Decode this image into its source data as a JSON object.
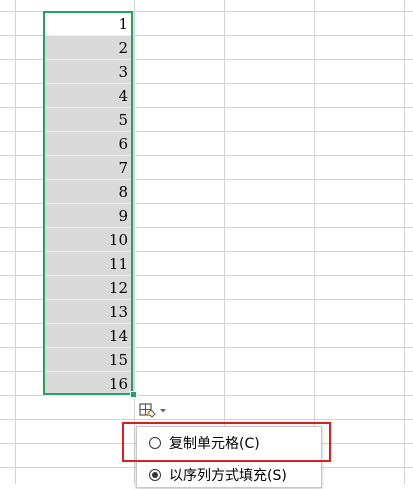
{
  "sheet": {
    "column_values": [
      "1",
      "2",
      "3",
      "4",
      "5",
      "6",
      "7",
      "8",
      "9",
      "10",
      "11",
      "12",
      "13",
      "14",
      "15",
      "16"
    ]
  },
  "autofill_menu": {
    "options": [
      {
        "label": "复制单元格(C)",
        "selected": false
      },
      {
        "label": "以序列方式填充(S)",
        "selected": true
      }
    ]
  },
  "colors": {
    "selection_border": "#21a366",
    "selection_fill": "#d9d9d9",
    "highlight_box": "#d71f1f",
    "grid_line": "#d4d4d4"
  },
  "icons": {
    "autofill_options": "autofill-options-icon",
    "dropdown": "chevron-down-icon"
  }
}
